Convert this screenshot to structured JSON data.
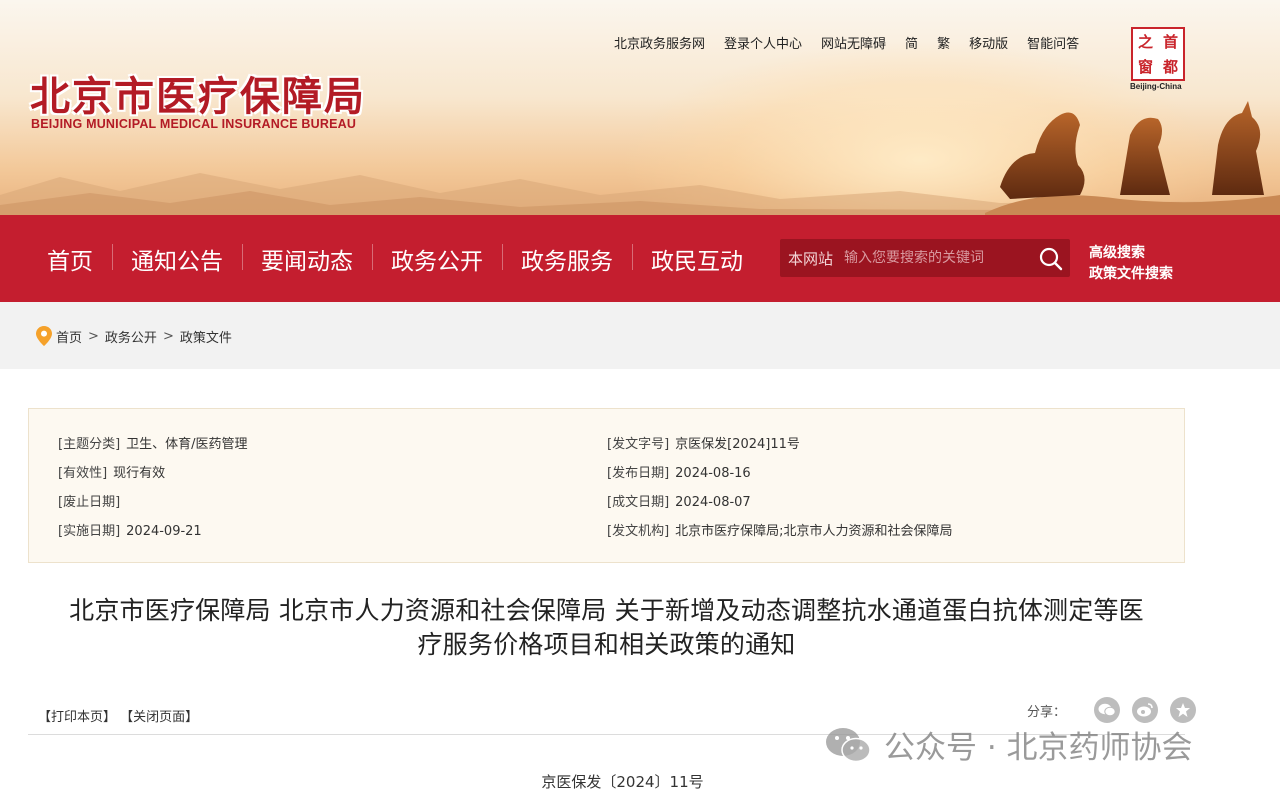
{
  "header": {
    "logo_cn": "北京市医疗保障局",
    "logo_en": "BEIJING MUNICIPAL MEDICAL INSURANCE BUREAU",
    "top_links": [
      "北京政务服务网",
      "登录个人中心",
      "网站无障碍",
      "简",
      "繁",
      "移动版",
      "智能问答"
    ],
    "seal_chars": [
      "首",
      "都",
      "之",
      "窗"
    ],
    "seal_caption": "Beijing-China"
  },
  "nav": {
    "items": [
      "首页",
      "通知公告",
      "要闻动态",
      "政务公开",
      "政务服务",
      "政民互动"
    ],
    "search_scope": "本网站",
    "search_placeholder": "输入您要搜索的关键词",
    "advanced_search": "高级搜索",
    "policy_search": "政策文件搜索"
  },
  "breadcrumb": {
    "items": [
      "首页",
      "政务公开",
      "政策文件"
    ],
    "separator": ">"
  },
  "meta": {
    "left": [
      {
        "label": "[主题分类]",
        "value": "卫生、体育/医药管理"
      },
      {
        "label": "[有效性]",
        "value": "现行有效"
      },
      {
        "label": "[废止日期]",
        "value": ""
      },
      {
        "label": "[实施日期]",
        "value": "2024-09-21"
      }
    ],
    "right": [
      {
        "label": "[发文字号]",
        "value": "京医保发[2024]11号"
      },
      {
        "label": "[发布日期]",
        "value": "2024-08-16"
      },
      {
        "label": "[成文日期]",
        "value": "2024-08-07"
      },
      {
        "label": "[发文机构]",
        "value": "北京市医疗保障局;北京市人力资源和社会保障局"
      }
    ]
  },
  "article": {
    "title_line1": "北京市医疗保障局 北京市人力资源和社会保障局 关于新增及动态调整抗水通道蛋白抗体测定等医",
    "title_line2": "疗服务价格项目和相关政策的通知",
    "print": "【打印本页】",
    "close": "【关闭页面】",
    "share_label": "分享：",
    "doc_number": "京医保发〔2024〕11号"
  },
  "watermark": "公众号 · 北京药师协会",
  "colors": {
    "nav_red": "#c41e2f",
    "logo_red": "#b31b25",
    "meta_bg": "#fdf9f1"
  }
}
